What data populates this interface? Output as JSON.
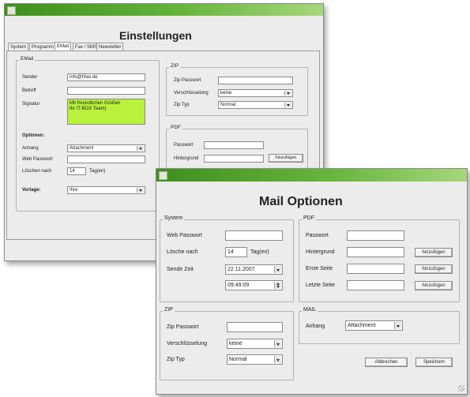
{
  "back_window": {
    "title": "Einstellungen",
    "tabs": [
      "System",
      "Programm",
      "EMail",
      "Fax / SMS",
      "Newsletter"
    ],
    "active_tab": "EMail",
    "email": {
      "legend": "EMail",
      "sender_label": "Sender",
      "sender_value": "info@hfax.de",
      "subject_label": "Betreff",
      "subject_value": "",
      "signature_label": "Signatur",
      "signature_line1": "Mit freundlichen Grüßen",
      "signature_line2": "Ihr IT-BOX Team)",
      "options_label": "Optionen:",
      "attachment_label": "Anhang",
      "attachment_value": "Attachment",
      "webpass_label": "Web Passwort",
      "webpass_value": "",
      "delete_label": "Löschen nach",
      "delete_value": "14",
      "days_label": "Tag(en)",
      "template_label": "Vorlage:",
      "template_value": "Ihre"
    },
    "zip": {
      "legend": "ZIP",
      "password_label": "Zip Passwort",
      "password_value": "",
      "encryption_label": "Verschlüsselung",
      "encryption_value": "keine",
      "type_label": "Zip Typ",
      "type_value": "Normal"
    },
    "pdf": {
      "legend": "PDF",
      "password_label": "Passwort",
      "password_value": "",
      "background_label": "Hintergrund",
      "background_value": "",
      "add_button": "hinzufügen"
    }
  },
  "front_window": {
    "title": "Mail Optionen",
    "system": {
      "legend": "System",
      "webpass_label": "Web Passwort",
      "webpass_value": "",
      "delete_label": "Lösche nach",
      "delete_value": "14",
      "days_label": "Tag(en)",
      "send_time_label": "Sende Zeit",
      "date_value": "22.11.2007",
      "time_value": "09:49:09"
    },
    "pdf": {
      "legend": "PDF",
      "password_label": "Passwort",
      "background_label": "Hintergrund",
      "first_page_label": "Erste Seite",
      "last_page_label": "Letzte Seite",
      "add_button": "hinzufügen"
    },
    "zip": {
      "legend": "ZIP",
      "password_label": "Zip Passwort",
      "password_value": "",
      "encryption_label": "Verschlüsselung",
      "encryption_value": "keine",
      "type_label": "Zip Typ",
      "type_value": "Normal"
    },
    "mail": {
      "legend": "MAIL",
      "attachment_label": "Anhang",
      "attachment_value": "Attachment"
    },
    "cancel_button": "Abbrechen",
    "save_button": "Speichern"
  },
  "colors": {
    "titlebar_dark": "#3f8f1e",
    "titlebar_light": "#a6d77c",
    "signature_bg": "#b8f23a"
  }
}
